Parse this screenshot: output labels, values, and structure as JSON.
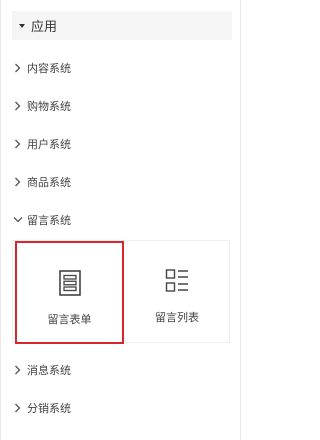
{
  "section": {
    "title": "应用",
    "icon": "caret-down-icon"
  },
  "menu": {
    "items": [
      {
        "label": "内容系统",
        "icon": "chevron-right-icon"
      },
      {
        "label": "购物系统",
        "icon": "chevron-right-icon"
      },
      {
        "label": "用户系统",
        "icon": "chevron-right-icon"
      },
      {
        "label": "商品系统",
        "icon": "chevron-right-icon"
      },
      {
        "label": "留言系统",
        "icon": "chevron-down-icon",
        "expanded": true
      },
      {
        "label": "消息系统",
        "icon": "chevron-right-icon"
      },
      {
        "label": "分销系统",
        "icon": "chevron-right-icon"
      }
    ]
  },
  "message_system": {
    "cards": [
      {
        "label": "留言表单",
        "icon": "form-icon",
        "selected": true
      },
      {
        "label": "留言列表",
        "icon": "list-icon",
        "selected": false
      }
    ]
  },
  "colors": {
    "selected_border": "#d9262c",
    "header_bg": "#f5f5f5"
  }
}
